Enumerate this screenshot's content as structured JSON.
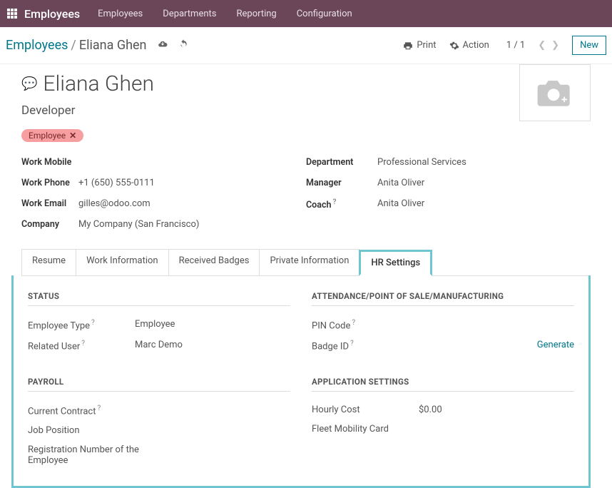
{
  "topbar": {
    "module": "Employees",
    "menu": [
      "Employees",
      "Departments",
      "Reporting",
      "Configuration"
    ]
  },
  "breadcrumb": {
    "root": "Employees",
    "leaf": "Eliana Ghen",
    "print": "Print",
    "action": "Action",
    "pager": "1 / 1",
    "new": "New"
  },
  "header": {
    "name": "Eliana Ghen",
    "position": "Developer",
    "tag": "Employee"
  },
  "left_info": {
    "work_mobile_lbl": "Work Mobile",
    "work_mobile_val": "",
    "work_phone_lbl": "Work Phone",
    "work_phone_val": "+1 (650) 555-0111",
    "work_email_lbl": "Work Email",
    "work_email_val": "gilles@odoo.com",
    "company_lbl": "Company",
    "company_val": "My Company (San Francisco)"
  },
  "right_info": {
    "department_lbl": "Department",
    "department_val": "Professional Services",
    "manager_lbl": "Manager",
    "manager_val": "Anita Oliver",
    "coach_lbl": "Coach",
    "coach_val": "Anita Oliver"
  },
  "tabs": [
    "Resume",
    "Work Information",
    "Received Badges",
    "Private Information",
    "HR Settings"
  ],
  "hr": {
    "status_head": "STATUS",
    "emp_type_lbl": "Employee Type",
    "emp_type_val": "Employee",
    "rel_user_lbl": "Related User",
    "rel_user_val": "Marc Demo",
    "payroll_head": "PAYROLL",
    "contract_lbl": "Current Contract",
    "jobpos_lbl": "Job Position",
    "regnum_lbl": "Registration Number of the Employee",
    "apm_head": "ATTENDANCE/POINT OF SALE/MANUFACTURING",
    "pin_lbl": "PIN Code",
    "badge_lbl": "Badge ID",
    "generate": "Generate",
    "app_head": "APPLICATION SETTINGS",
    "hourly_lbl": "Hourly Cost",
    "hourly_val": "$0.00",
    "fleet_lbl": "Fleet Mobility Card"
  }
}
